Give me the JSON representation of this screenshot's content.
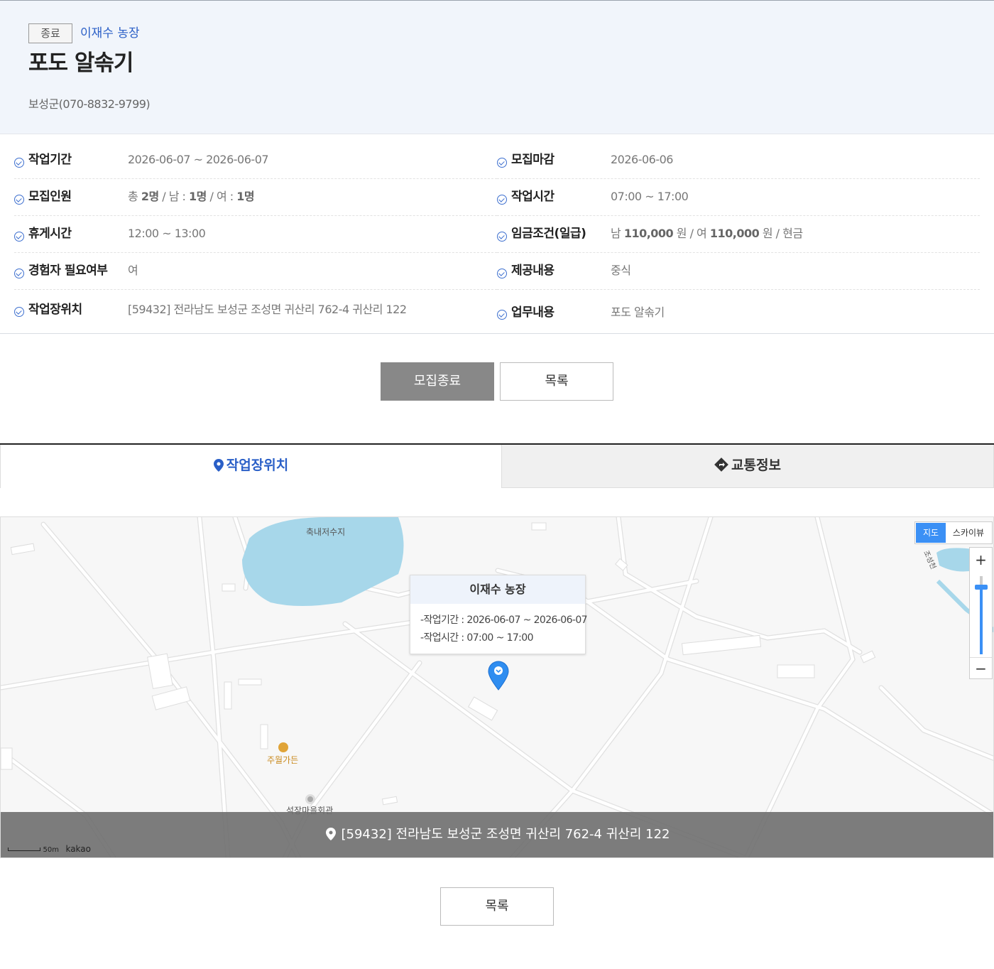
{
  "header": {
    "status_badge": "종료",
    "farm_name": "이재수 농장",
    "title": "포도 알솎기",
    "contact": "보성군(070-8832-9799)"
  },
  "info": {
    "left": [
      {
        "label": "작업기간",
        "value": "2026-06-07 ~ 2026-06-07"
      },
      {
        "label": "모집인원",
        "value": "",
        "parts": {
          "pre": "총 ",
          "total": "2명",
          "m_lbl": " / 남 : ",
          "male": "1명",
          "f_lbl": " / 여 : ",
          "female": "1명"
        }
      },
      {
        "label": "휴게시간",
        "value": "12:00 ~ 13:00"
      },
      {
        "label": "경험자 필요여부",
        "value": "여"
      },
      {
        "label": "작업장위치",
        "value": "[59432] 전라남도 보성군 조성면 귀산리 762-4 귀산리 122"
      }
    ],
    "right": [
      {
        "label": "모집마감",
        "value": "2026-06-06"
      },
      {
        "label": "작업시간",
        "value": "07:00 ~ 17:00"
      },
      {
        "label": "임금조건(일급)",
        "value": "",
        "parts": {
          "m_lbl": "남 ",
          "male": "110,000",
          "unit1": " 원 / 여 ",
          "female": "110,000",
          "unit2": " 원 / 현금"
        }
      },
      {
        "label": "제공내용",
        "value": "중식"
      },
      {
        "label": "업무내용",
        "value": "포도 알솎기"
      }
    ]
  },
  "buttons": {
    "end_label": "모집종료",
    "list_label": "목록",
    "list_label_bottom": "목록"
  },
  "tabs": {
    "location": "작업장위치",
    "traffic": "교통정보"
  },
  "map": {
    "type_map": "지도",
    "type_sky": "스카이뷰",
    "zoom_in": "+",
    "zoom_out": "−",
    "labels": {
      "reservoir": "축내저수지",
      "restaurant": "주월가든",
      "hall": "석장마을회관",
      "road": "조성천"
    },
    "popup": {
      "title": "이재수 농장",
      "period": "-작업기간 : 2026-06-07 ~ 2026-06-07",
      "time": "-작업시간 : 07:00 ~ 17:00"
    },
    "address": "[59432] 전라남도 보성군 조성면 귀산리 762-4 귀산리 122",
    "scale": "50m",
    "brand": "kakao"
  },
  "colors": {
    "accent": "#2a5fc7",
    "map_blue": "#3b90f5",
    "water": "#a7d7ea"
  }
}
